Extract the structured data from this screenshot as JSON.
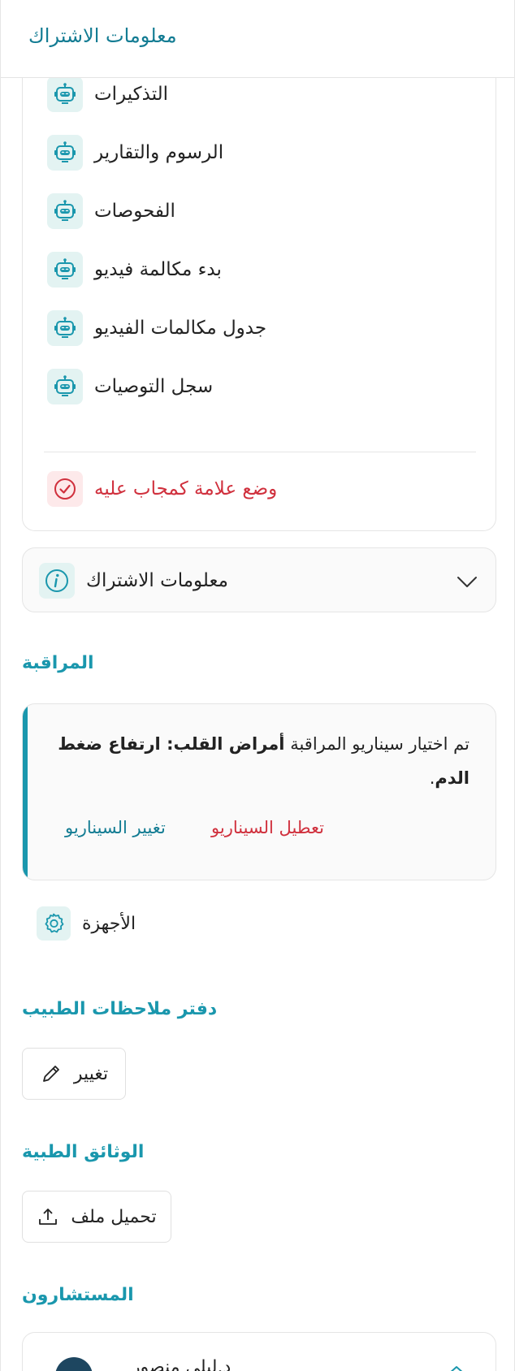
{
  "header": {
    "title": "معلومات الاشتراك"
  },
  "menu": {
    "items": [
      {
        "label": "التذكيرات"
      },
      {
        "label": "الرسوم والتقارير"
      },
      {
        "label": "الفحوصات"
      },
      {
        "label": "بدء مكالمة فيديو"
      },
      {
        "label": "جدول مكالمات الفيديو"
      },
      {
        "label": "سجل التوصيات"
      }
    ],
    "mark_answered": "وضع علامة كمجاب عليه"
  },
  "subscription": {
    "label": "معلومات الاشتراك"
  },
  "monitoring": {
    "title": "المراقبة",
    "text_prefix": "تم اختيار سيناريو المراقبة",
    "scenario_bold": "أمراض القلب: ارتفاع ضغط الدم",
    "text_suffix": ".",
    "disable_label": "تعطيل السيناريو",
    "change_label": "تغيير السيناريو"
  },
  "devices": {
    "label": "الأجهزة"
  },
  "doctor_notes": {
    "title": "دفتر ملاحظات الطبيب",
    "change_label": "تغيير"
  },
  "documents": {
    "title": "الوثائق الطبية",
    "upload_label": "تحميل ملف"
  },
  "consultants": {
    "title": "المستشارون",
    "name": "د.ليلى منصور"
  },
  "colors": {
    "teal": "#1a97ad",
    "teal_dark": "#137c93",
    "red": "#d0303d"
  }
}
